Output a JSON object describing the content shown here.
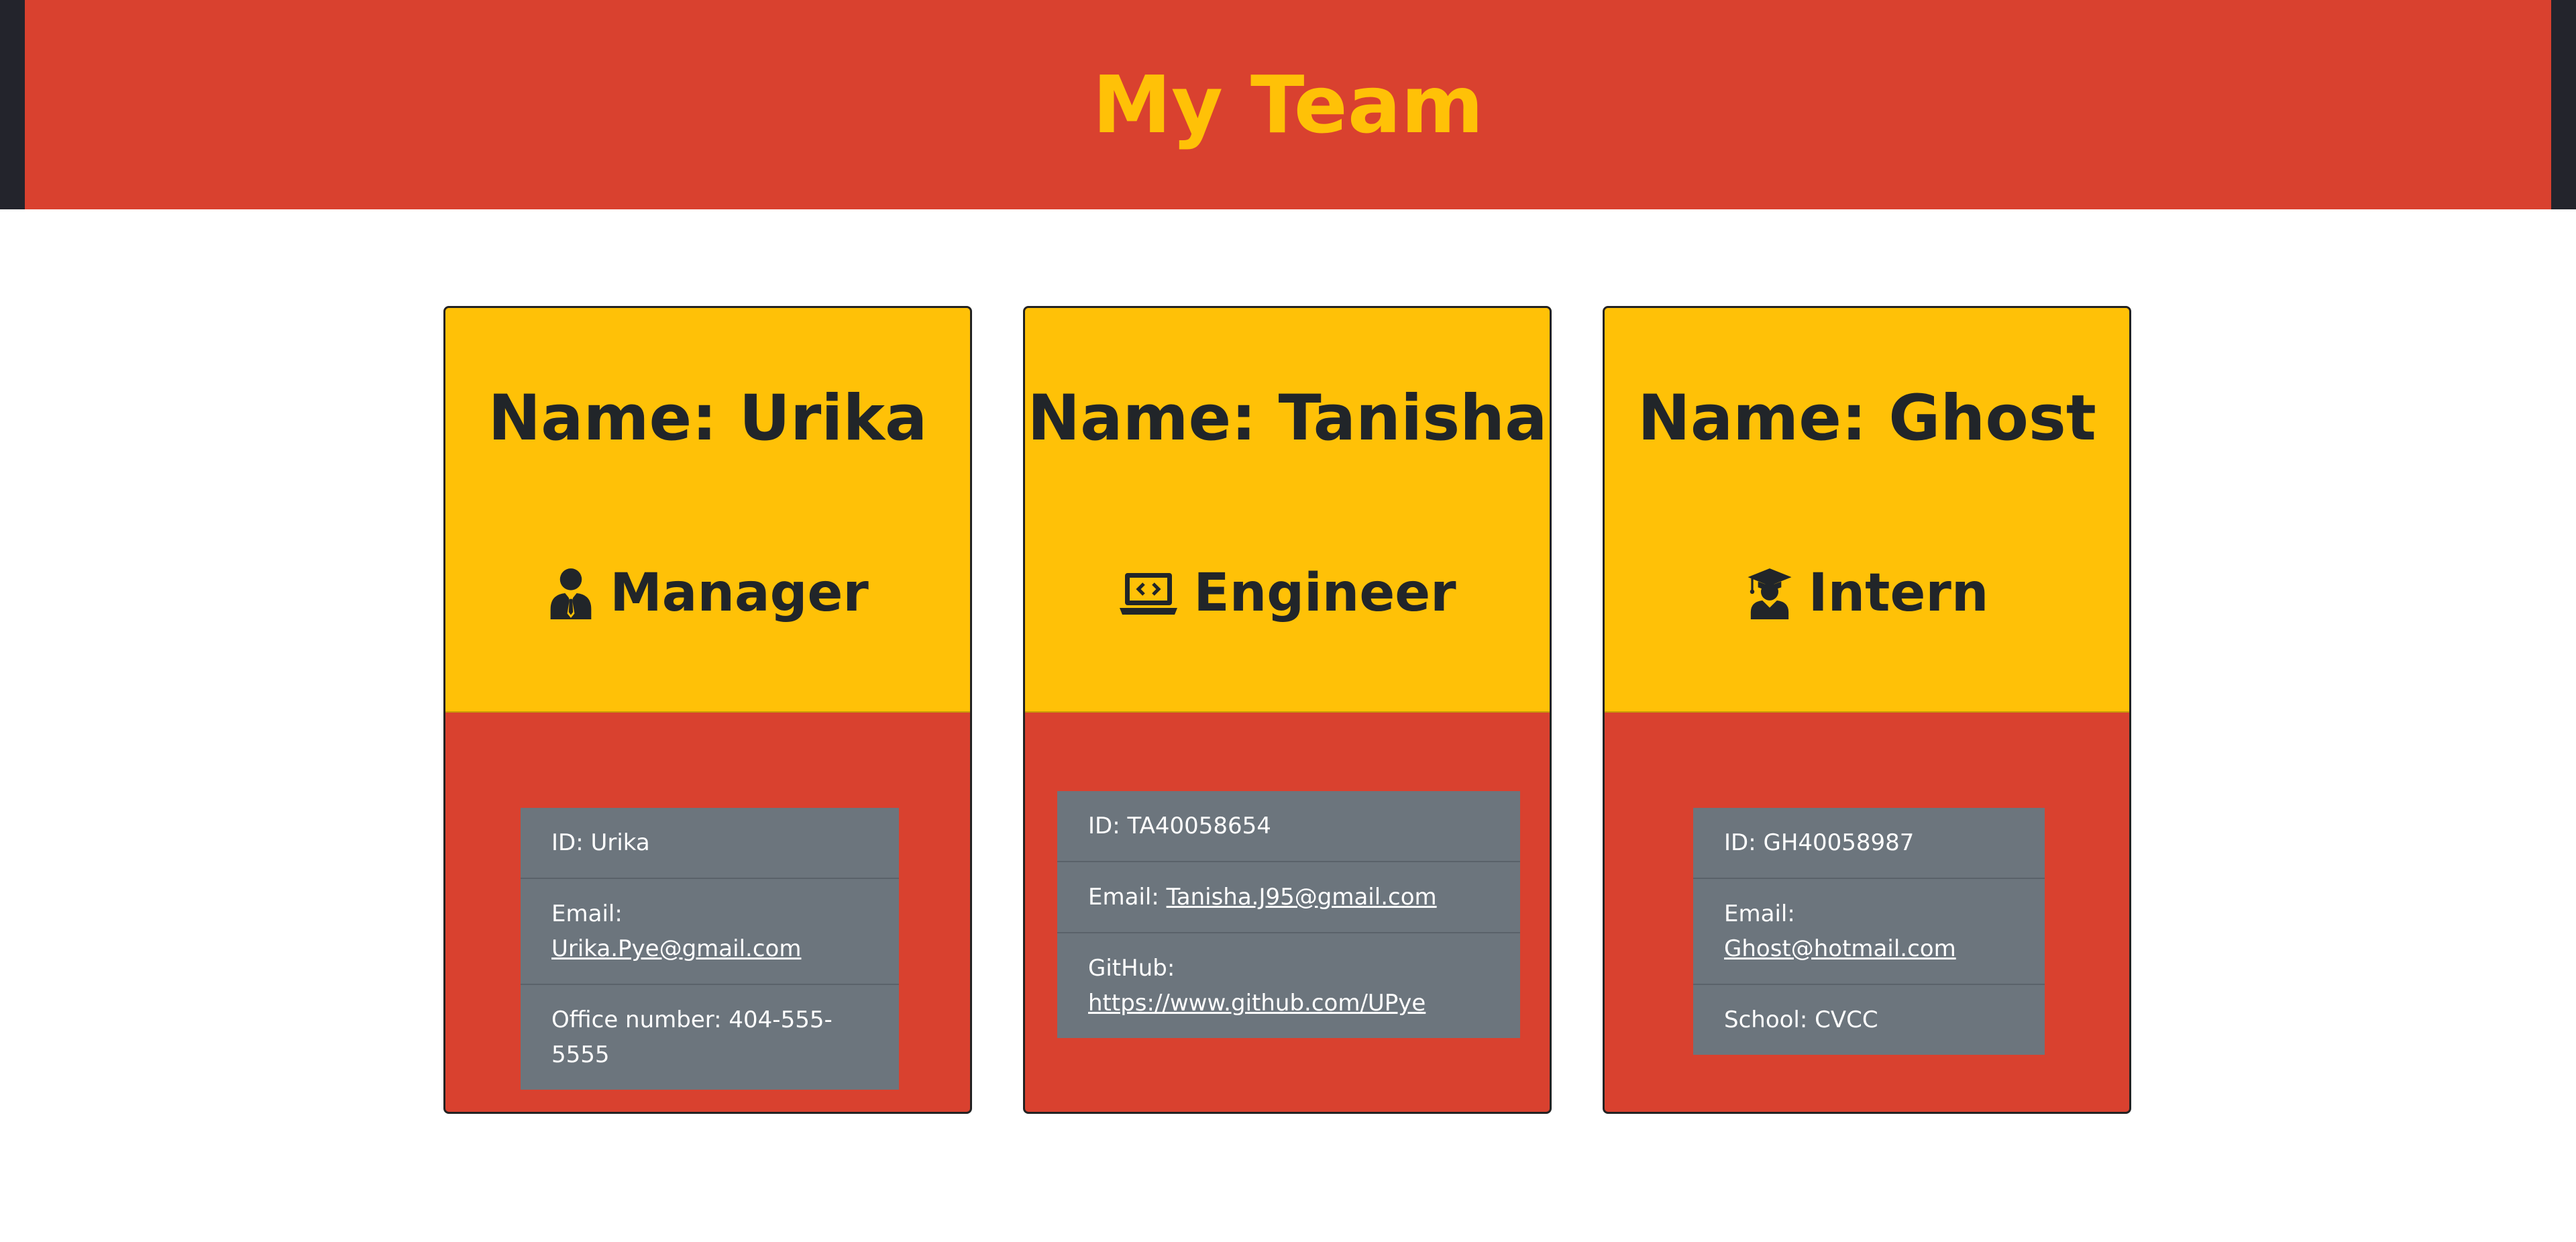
{
  "header": {
    "title": "My Team",
    "background_color": "#d9412f",
    "title_color": "#ffc107"
  },
  "cards": [
    {
      "name": "Name: Urika",
      "role": "Manager",
      "role_icon": "manager-icon",
      "id_text": "ID: Urika",
      "email_label": "Email: ",
      "email": "Urika.Pye@gmail.com",
      "extra_text": "Office number: 404-555-5555"
    },
    {
      "name": "Name: Tanisha",
      "role": "Engineer",
      "role_icon": "laptop-code-icon",
      "id_text": "ID: TA40058654",
      "email_label": "Email: ",
      "email": "Tanisha.J95@gmail.com",
      "extra_label": "GitHub:",
      "extra_link": "https://www.github.com/UPye"
    },
    {
      "name": "Name: Ghost",
      "role": "Intern",
      "role_icon": "graduate-icon",
      "id_text": "ID: GH40058987",
      "email_label": "Email: ",
      "email": "Ghost@hotmail.com",
      "extra_text": "School: CVCC"
    }
  ],
  "colors": {
    "card_top": "#ffc107",
    "card_bottom": "#d9412f",
    "list_bg": "#6c757d",
    "text_dark": "#212529"
  }
}
